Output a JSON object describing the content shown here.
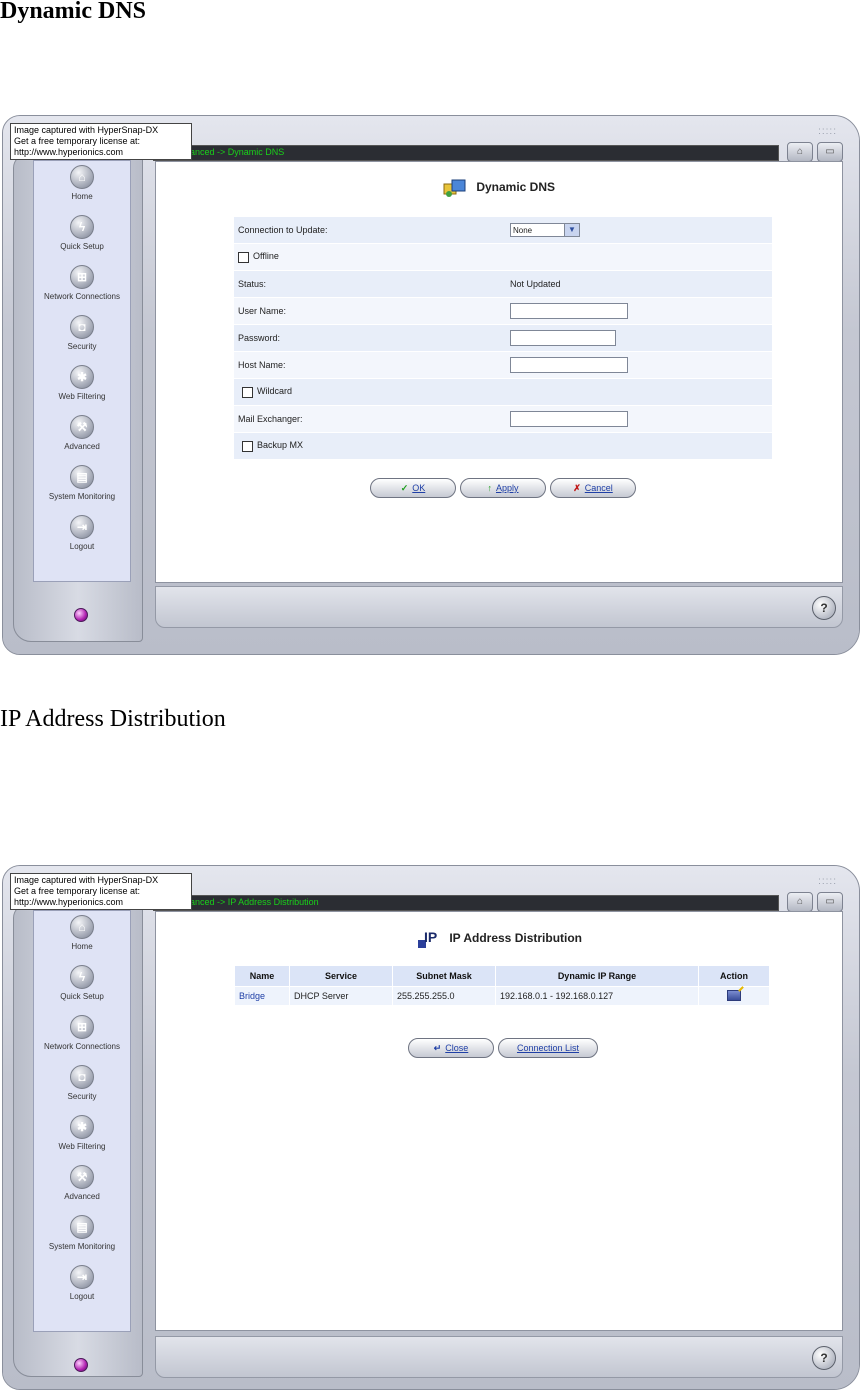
{
  "doc": {
    "heading1": "Dynamic DNS",
    "heading2": "IP Address Distribution"
  },
  "watermark": {
    "line1": "Image captured with HyperSnap-DX",
    "line2": "Get a free temporary license at:",
    "line3": "http://www.hyperionics.com"
  },
  "sidebar": {
    "items": [
      {
        "label": "Home",
        "icon": "home-icon"
      },
      {
        "label": "Quick Setup",
        "icon": "lightning-icon"
      },
      {
        "label": "Network Connections",
        "icon": "network-icon"
      },
      {
        "label": "Security",
        "icon": "security-icon"
      },
      {
        "label": "Web Filtering",
        "icon": "web-filter-icon"
      },
      {
        "label": "Advanced",
        "icon": "advanced-icon"
      },
      {
        "label": "System Monitoring",
        "icon": "monitor-icon"
      },
      {
        "label": "Logout",
        "icon": "logout-icon"
      }
    ]
  },
  "help_label": "?",
  "screen1": {
    "breadcrumb": "anced -> Dynamic DNS",
    "title": "Dynamic DNS",
    "connection_label": "Connection to Update:",
    "connection_value": "None",
    "offline_label": "Offline",
    "status_label": "Status:",
    "status_value": "Not Updated",
    "username_label": "User Name:",
    "password_label": "Password:",
    "hostname_label": "Host Name:",
    "wildcard_label": "Wildcard",
    "mailx_label": "Mail Exchanger:",
    "backupmx_label": "Backup MX",
    "ok_label": "OK",
    "apply_label": "Apply",
    "cancel_label": "Cancel"
  },
  "screen2": {
    "breadcrumb": "anced -> IP Address Distribution",
    "title": "IP Address Distribution",
    "columns": [
      "Name",
      "Service",
      "Subnet Mask",
      "Dynamic IP Range",
      "Action"
    ],
    "rows": [
      {
        "name": "Bridge",
        "service": "DHCP Server",
        "mask": "255.255.255.0",
        "range": "192.168.0.1 - 192.168.0.127",
        "action_icon": "edit-icon"
      }
    ],
    "close_label": "Close",
    "connection_list_label": "Connection List"
  }
}
